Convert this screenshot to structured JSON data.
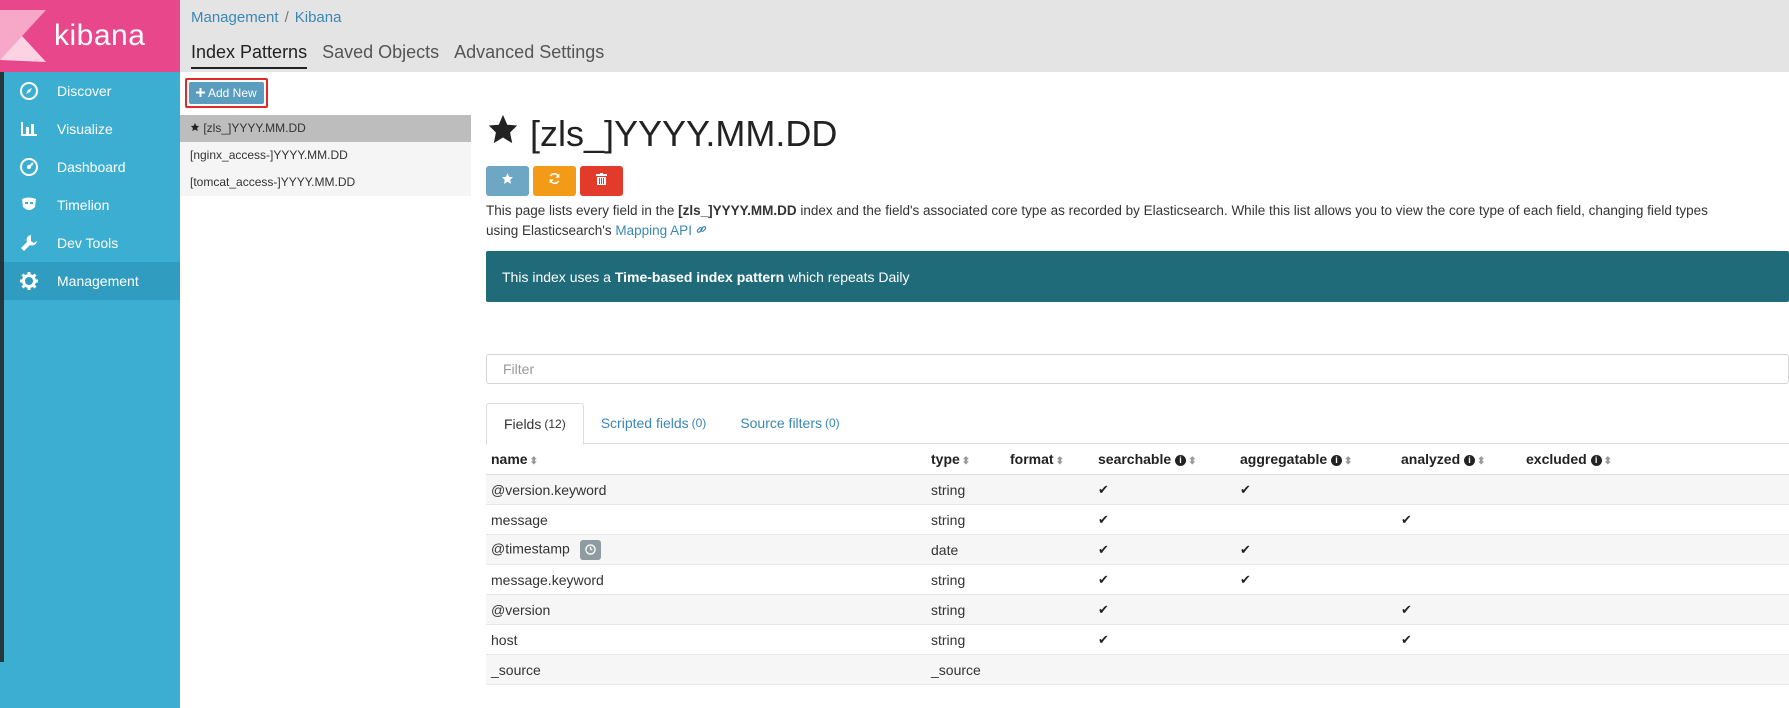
{
  "app": {
    "logo_text": "kibana",
    "brand_color": "#e8488b",
    "sidebar_color": "#3caed2"
  },
  "sidebar": {
    "items": [
      {
        "label": "Discover",
        "icon": "compass-icon"
      },
      {
        "label": "Visualize",
        "icon": "bar-chart-icon"
      },
      {
        "label": "Dashboard",
        "icon": "dashboard-gauge-icon"
      },
      {
        "label": "Timelion",
        "icon": "timelion-mask-icon"
      },
      {
        "label": "Dev Tools",
        "icon": "wrench-icon"
      },
      {
        "label": "Management",
        "icon": "gear-icon",
        "active": true
      }
    ]
  },
  "breadcrumb": {
    "root": "Management",
    "separator": "/",
    "current": "Kibana"
  },
  "tabs": [
    {
      "label": "Index Patterns",
      "active": true
    },
    {
      "label": "Saved Objects"
    },
    {
      "label": "Advanced Settings"
    }
  ],
  "add_new": {
    "label": "Add New"
  },
  "index_patterns": [
    {
      "label": "[zls_]YYYY.MM.DD",
      "default": true
    },
    {
      "label": "[nginx_access-]YYYY.MM.DD"
    },
    {
      "label": "[tomcat_access-]YYYY.MM.DD"
    }
  ],
  "main": {
    "title": "[zls_]YYYY.MM.DD",
    "desc": {
      "p1": "This page lists every field in the ",
      "bold": "[zls_]YYYY.MM.DD",
      "p2": " index and the field's associated core type as recorded by Elasticsearch. While this list allows you to view the core type of each field, changing field types",
      "line2": "using Elasticsearch's ",
      "link": "Mapping API"
    },
    "notice": {
      "p1": "This index uses a ",
      "bold": "Time-based index pattern",
      "p2": " which repeats Daily"
    },
    "filter_placeholder": "Filter",
    "field_tabs": [
      {
        "label": "Fields",
        "count": "(12)"
      },
      {
        "label": "Scripted fields",
        "count": "(0)"
      },
      {
        "label": "Source filters",
        "count": "(0)"
      }
    ],
    "columns": {
      "name": "name",
      "type": "type",
      "format": "format",
      "searchable": "searchable",
      "aggregatable": "aggregatable",
      "analyzed": "analyzed",
      "excluded": "excluded"
    },
    "rows": [
      {
        "name": "@version.keyword",
        "type": "string",
        "searchable": true,
        "aggregatable": true,
        "analyzed": false
      },
      {
        "name": "message",
        "type": "string",
        "searchable": true,
        "aggregatable": false,
        "analyzed": true
      },
      {
        "name": "@timestamp",
        "type": "date",
        "searchable": true,
        "aggregatable": true,
        "analyzed": false,
        "time_field": true
      },
      {
        "name": "message.keyword",
        "type": "string",
        "searchable": true,
        "aggregatable": true,
        "analyzed": false
      },
      {
        "name": "@version",
        "type": "string",
        "searchable": true,
        "aggregatable": false,
        "analyzed": true
      },
      {
        "name": "host",
        "type": "string",
        "searchable": true,
        "aggregatable": false,
        "analyzed": true
      },
      {
        "name": "_source",
        "type": "_source",
        "searchable": false,
        "aggregatable": false,
        "analyzed": false
      }
    ]
  }
}
